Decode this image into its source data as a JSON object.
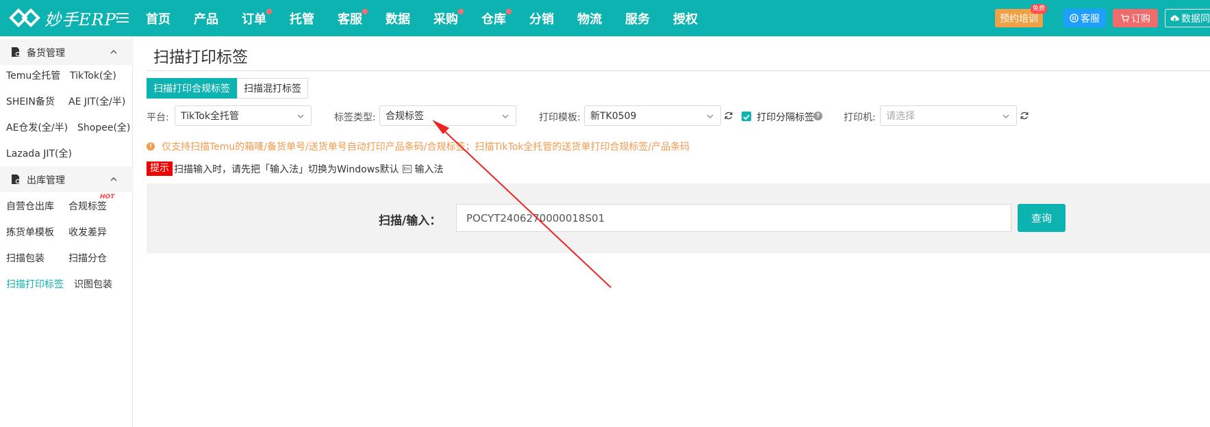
{
  "brand": {
    "logo_text": "妙手ERP"
  },
  "nav": {
    "items": [
      {
        "label": "首页",
        "dot": false
      },
      {
        "label": "产品",
        "dot": false
      },
      {
        "label": "订单",
        "dot": true
      },
      {
        "label": "托管",
        "dot": false
      },
      {
        "label": "客服",
        "dot": true
      },
      {
        "label": "数据",
        "dot": false
      },
      {
        "label": "采购",
        "dot": true
      },
      {
        "label": "仓库",
        "dot": true
      },
      {
        "label": "分销",
        "dot": false
      },
      {
        "label": "物流",
        "dot": false
      },
      {
        "label": "服务",
        "dot": false
      },
      {
        "label": "授权",
        "dot": false
      }
    ],
    "right": {
      "training": "预约培训",
      "free_badge": "免费",
      "service": "客服",
      "order": "订购",
      "sync": "数据同"
    }
  },
  "sidebar": {
    "groups": [
      {
        "label": "备货管理",
        "items": [
          "Temu全托管",
          "TikTok(全)",
          "SHEIN备货",
          "AE JIT(全/半)",
          "AE仓发(全/半)",
          "Shopee(全)",
          "Lazada JIT(全)"
        ]
      },
      {
        "label": "出库管理",
        "items": [
          "自营仓出库",
          "合规标签",
          "拣货单模板",
          "收发差异",
          "扫描包装",
          "扫描分仓",
          "扫描打印标签",
          "识图包装"
        ]
      }
    ],
    "hot_badge": "HOT"
  },
  "page": {
    "title": "扫描打印标签",
    "tabs": [
      "扫描打印合规标签",
      "扫描混打标签"
    ],
    "filters": {
      "platform_label": "平台:",
      "platform_value": "TikTok全托管",
      "label_type_label": "标签类型:",
      "label_type_value": "合规标签",
      "template_label": "打印模板:",
      "template_value": "新TK0509",
      "separator_label": "打印分隔标签",
      "printer_label": "打印机:",
      "printer_placeholder": "请选择"
    },
    "warning": "仅支持扫描Temu的箱唛/备货单号/送货单号自动打印产品条码/合规标签；扫描TikTok全托管的送货单打印合规标签/产品条码",
    "tip": {
      "badge": "提示",
      "text": "扫描输入时，请先把「输入法」切换为Windows默认",
      "ime_icon": "En",
      "ime_text": "输入法"
    },
    "scan": {
      "label": "扫描/输入：",
      "value": "POCYT2406270000018S01",
      "button": "查询"
    }
  },
  "colors": {
    "primary": "#0db3b0",
    "warning": "#f59a4c",
    "tip": "#ee0000",
    "annotation": "#ee2222"
  }
}
